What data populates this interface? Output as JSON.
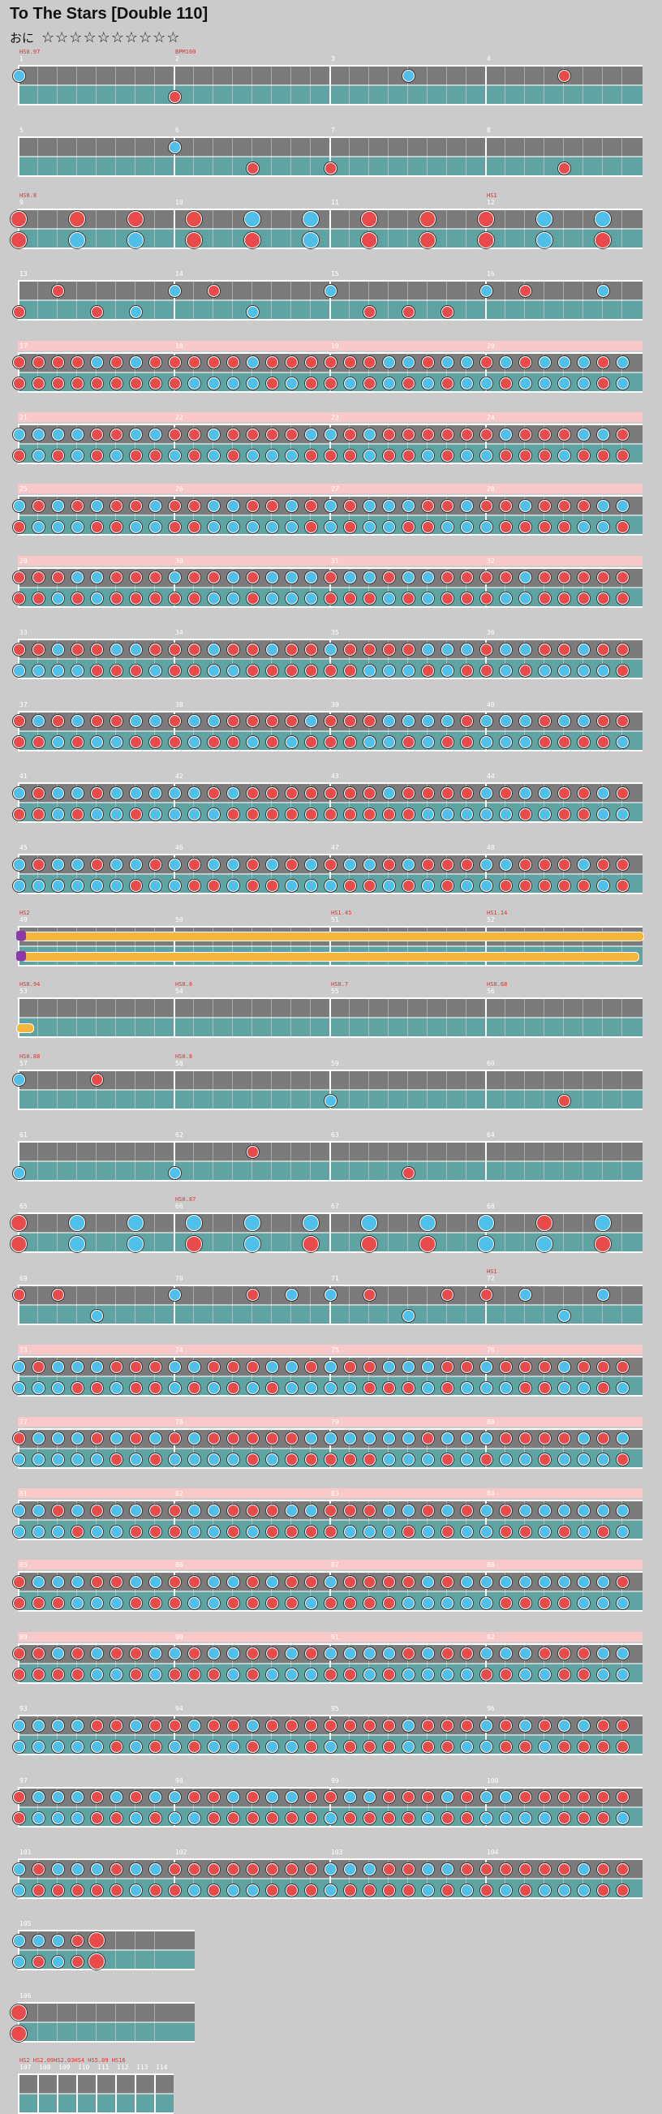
{
  "header": {
    "title": "To The Stars [Double 110]",
    "diff_label": "おに",
    "stars": "☆☆☆☆☆☆☆☆☆☆"
  },
  "colors": {
    "don": "#e94b4b",
    "ka": "#4fc0ea",
    "lane": "#7b7b7b",
    "lane_teal": "#5fa3a3",
    "gogo": "#f9c9c9"
  },
  "rows": [
    {
      "measures": [
        1,
        2,
        3,
        4
      ],
      "speed": [
        "HS0.97",
        "BPM100"
      ],
      "pink": false,
      "notes": "sparse"
    },
    {
      "measures": [
        5,
        6,
        7,
        8
      ],
      "pink": false,
      "notes": "sparse"
    },
    {
      "measures": [
        9,
        10,
        11,
        12
      ],
      "speed": [
        "HS0.8",
        "",
        "",
        "HS1"
      ],
      "pink": false,
      "notes": "big"
    },
    {
      "measures": [
        13,
        14,
        15,
        16
      ],
      "pink": false,
      "notes": "mid"
    },
    {
      "measures": [
        17,
        18,
        19,
        20
      ],
      "pink": true,
      "notes": "dense"
    },
    {
      "measures": [
        21,
        22,
        23,
        24
      ],
      "pink": true,
      "notes": "dense"
    },
    {
      "measures": [
        25,
        26,
        27,
        28
      ],
      "pink": true,
      "notes": "dense"
    },
    {
      "measures": [
        29,
        30,
        31,
        32
      ],
      "pink": true,
      "notes": "dense"
    },
    {
      "measures": [
        33,
        34,
        35,
        36
      ],
      "pink": false,
      "notes": "dense"
    },
    {
      "measures": [
        37,
        38,
        39,
        40
      ],
      "pink": false,
      "notes": "dense"
    },
    {
      "measures": [
        41,
        42,
        43,
        44
      ],
      "pink": false,
      "notes": "dense"
    },
    {
      "measures": [
        45,
        46,
        47,
        48
      ],
      "pink": false,
      "notes": "dense"
    },
    {
      "measures": [
        49,
        50,
        51,
        52
      ],
      "speed": [
        "HS2",
        "",
        "HS1.45",
        "HS1.14"
      ],
      "pink": false,
      "notes": "roll"
    },
    {
      "measures": [
        53,
        54,
        55,
        56
      ],
      "speed": [
        "HS0.94",
        "HS0.8",
        "HS0.7",
        "HS0.68"
      ],
      "pink": false,
      "notes": "rollend"
    },
    {
      "measures": [
        57,
        58,
        59,
        60
      ],
      "speed": [
        "HS0.88",
        "HS0.8",
        "",
        ""
      ],
      "pink": false,
      "notes": "sparse"
    },
    {
      "measures": [
        61,
        62,
        63,
        64
      ],
      "pink": false,
      "notes": "sparse"
    },
    {
      "measures": [
        65,
        66,
        67,
        68
      ],
      "speed": [
        "",
        "HS0.87",
        "",
        ""
      ],
      "pink": false,
      "notes": "big"
    },
    {
      "measures": [
        69,
        70,
        71,
        72
      ],
      "speed": [
        "",
        "",
        "",
        "HS1"
      ],
      "pink": false,
      "notes": "mid"
    },
    {
      "measures": [
        73,
        74,
        75,
        76
      ],
      "pink": true,
      "notes": "dense"
    },
    {
      "measures": [
        77,
        78,
        79,
        80
      ],
      "pink": true,
      "notes": "dense"
    },
    {
      "measures": [
        81,
        82,
        83,
        84
      ],
      "pink": true,
      "notes": "dense"
    },
    {
      "measures": [
        85,
        86,
        87,
        88
      ],
      "pink": true,
      "notes": "dense"
    },
    {
      "measures": [
        89,
        90,
        91,
        92
      ],
      "pink": true,
      "notes": "dense"
    },
    {
      "measures": [
        93,
        94,
        95,
        96
      ],
      "pink": false,
      "notes": "dense"
    },
    {
      "measures": [
        97,
        98,
        99,
        100
      ],
      "pink": false,
      "notes": "dense"
    },
    {
      "measures": [
        101,
        102,
        103,
        104
      ],
      "pink": false,
      "notes": "dense"
    },
    {
      "measures": [
        105
      ],
      "pink": false,
      "notes": "short"
    },
    {
      "measures": [
        106
      ],
      "pink": false,
      "notes": "end"
    },
    {
      "measures": [
        107,
        108,
        109,
        110,
        111,
        112,
        113,
        114
      ],
      "speed": [
        "HS2 HS2.09HS2.03HS4 HS5.09 HS16"
      ],
      "pink": false,
      "notes": "tiny"
    }
  ]
}
